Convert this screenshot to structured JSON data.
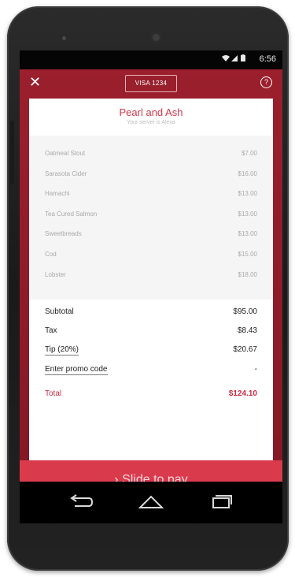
{
  "status_bar": {
    "time": "6:56",
    "signal_icons": "wifi-signal-battery"
  },
  "header": {
    "close_icon": "✕",
    "card_label": "VISA 1234",
    "help_icon": "?"
  },
  "restaurant": {
    "name": "Pearl and Ash",
    "server_text": "Your server is Alexa"
  },
  "items": [
    {
      "name": "Oatmeal Stout",
      "price": "$7.00"
    },
    {
      "name": "Sarasota Cider",
      "price": "$16.00"
    },
    {
      "name": "Hamachi",
      "price": "$13.00"
    },
    {
      "name": "Tea Cured Salmon",
      "price": "$13.00"
    },
    {
      "name": "Sweetbreads",
      "price": "$13.00"
    },
    {
      "name": "Cod",
      "price": "$15.00"
    },
    {
      "name": "Lobster",
      "price": "$18.00"
    }
  ],
  "totals": {
    "subtotal_label": "Subtotal",
    "subtotal_value": "$95.00",
    "tax_label": "Tax",
    "tax_value": "$8.43",
    "tip_label": "Tip (20%)",
    "tip_value": "$20.67",
    "promo_label": "Enter promo code",
    "promo_value": "-",
    "total_label": "Total",
    "total_value": "$124.10"
  },
  "slide_to_pay": "› Slide to pay",
  "colors": {
    "brand_red": "#8f1a28",
    "accent_red": "#d93b4d",
    "total_red": "#c82c42"
  }
}
